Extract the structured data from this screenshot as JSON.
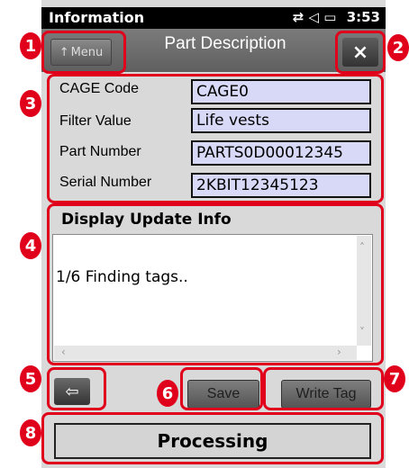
{
  "status_bar": {
    "title": "Information",
    "icons": [
      "sync-icon",
      "volume-icon",
      "battery-icon"
    ],
    "icon_glyphs": "⇄ ◁ ▭",
    "time": "3:53"
  },
  "title_bar": {
    "menu_label": "Menu",
    "menu_icon": "up-arrow-icon",
    "title": "Part Description",
    "close_glyph": "×"
  },
  "fields": [
    {
      "label": "CAGE Code",
      "value": "CAGE0"
    },
    {
      "label": "Filter Value",
      "value": "Life vests"
    },
    {
      "label": "Part Number",
      "value": "PARTS0D00012345"
    },
    {
      "label": "Serial Number",
      "value": "2KBIT12345123"
    }
  ],
  "info": {
    "header": "Display Update Info",
    "text": "1/6 Finding tags.."
  },
  "buttons": {
    "back_glyph": "⇦",
    "save": "Save",
    "write_tag": "Write Tag"
  },
  "status": "Processing",
  "badges": [
    "1",
    "2",
    "3",
    "4",
    "5",
    "6",
    "7",
    "8"
  ],
  "colors": {
    "callout": "#e0001b",
    "field_bg": "#d7d9f7",
    "title_bar": "#6b6b6b"
  }
}
